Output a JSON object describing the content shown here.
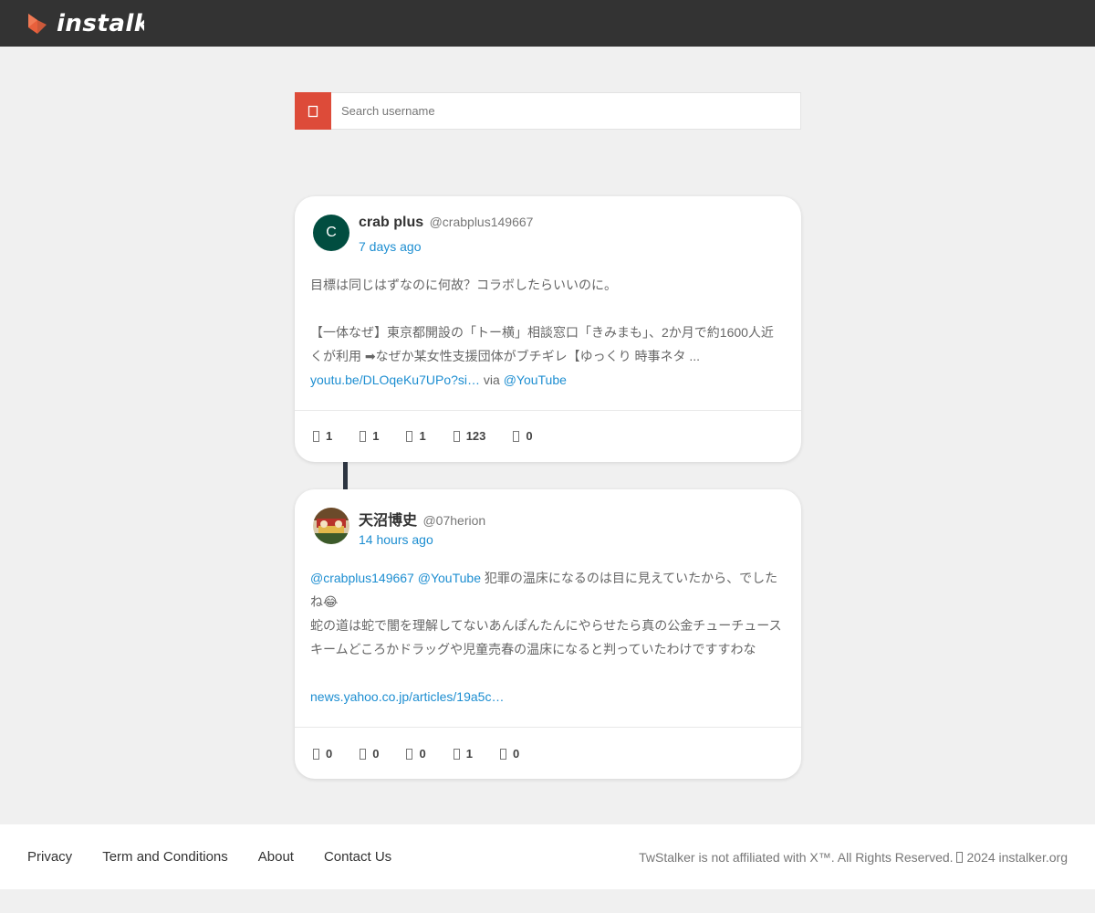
{
  "brand": {
    "name": "instalker",
    "accent": "#dd4b39",
    "logo_color": "#e8603c"
  },
  "search": {
    "placeholder": "Search username",
    "icon": "search-icon"
  },
  "posts": [
    {
      "display_name": "crab plus",
      "handle": "@crabplus149667",
      "time": "7 days ago",
      "avatar_letter": "C",
      "lines": [
        "目標は同じはずなのに何故？コラボしたらいいのに。",
        "【一体なぜ】東京都開設の「トー横」相談窓口「きみまも」、2か月で約1600人近",
        "くが利用 ➡なぜか某女性支援団体がブチギレ【ゆっくり 時事ネタ ..."
      ],
      "link": "youtu.be/DLOqeKu7UPo?si…",
      "via": "via",
      "via_link": "@YouTube",
      "stats": {
        "replies": "1",
        "retweets": "1",
        "quotes": "1",
        "likes": "123",
        "views": "0"
      }
    },
    {
      "display_name": "天沼博史",
      "handle": "@07herion",
      "time": "14 hours ago",
      "mention1": "@crabplus149667",
      "mention2": "@YouTube",
      "lines": [
        "犯罪の温床になるのは目に見えていたから、でした",
        "ね😂",
        "蛇の道は蛇で闇を理解してないあんぽんたんにやらせたら真の公金チューチュース",
        "キームどころかドラッグや児童売春の温床になると判っていたわけですすわな"
      ],
      "link": "news.yahoo.co.jp/articles/19a5c…",
      "stats": {
        "replies": "0",
        "retweets": "0",
        "quotes": "0",
        "likes": "1",
        "views": "0"
      }
    }
  ],
  "footer": {
    "links": [
      "Privacy",
      "Term and Conditions",
      "About",
      "Contact Us"
    ],
    "copyright": "TwStalker is not affiliated with X™. All Rights Reserved. ",
    "copyright_year": "2024 instalker.org"
  }
}
